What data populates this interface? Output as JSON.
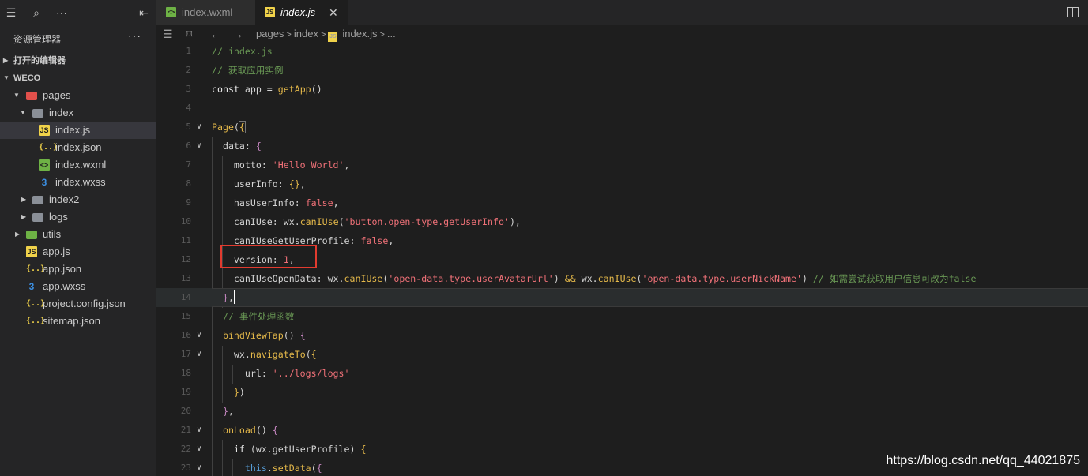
{
  "sidebar": {
    "explorer_title": "资源管理器",
    "more": "···",
    "open_editors": "打开的编辑器",
    "project": "WECO",
    "tree": [
      {
        "label": "pages",
        "icon": "folder-red-icon"
      },
      {
        "label": "index",
        "icon": "folder-icon"
      },
      {
        "label": "index.js",
        "icon": "js-file-icon"
      },
      {
        "label": "index.json",
        "icon": "json-file-icon"
      },
      {
        "label": "index.wxml",
        "icon": "wxml-file-icon"
      },
      {
        "label": "index.wxss",
        "icon": "wxss-file-icon"
      },
      {
        "label": "index2",
        "icon": "folder-icon"
      },
      {
        "label": "logs",
        "icon": "folder-icon"
      },
      {
        "label": "utils",
        "icon": "folder-green-icon"
      },
      {
        "label": "app.js",
        "icon": "js-file-icon"
      },
      {
        "label": "app.json",
        "icon": "json-file-icon"
      },
      {
        "label": "app.wxss",
        "icon": "wxss-file-icon"
      },
      {
        "label": "project.config.json",
        "icon": "json-file-icon"
      },
      {
        "label": "sitemap.json",
        "icon": "json-file-icon"
      }
    ]
  },
  "tabs": {
    "wxml": "index.wxml",
    "js": "index.js",
    "close": "✕"
  },
  "breadcrumb": {
    "pages": "pages",
    "index": "index",
    "file": "index.js",
    "ellipsis": "..."
  },
  "editor": {
    "line_numbers": [
      "1",
      "2",
      "3",
      "4",
      "5",
      "6",
      "7",
      "8",
      "9",
      "10",
      "11",
      "12",
      "13",
      "14",
      "15",
      "16",
      "17",
      "18",
      "19",
      "20",
      "21",
      "22",
      "23"
    ]
  },
  "watermark": "https://blog.csdn.net/qq_44021875"
}
